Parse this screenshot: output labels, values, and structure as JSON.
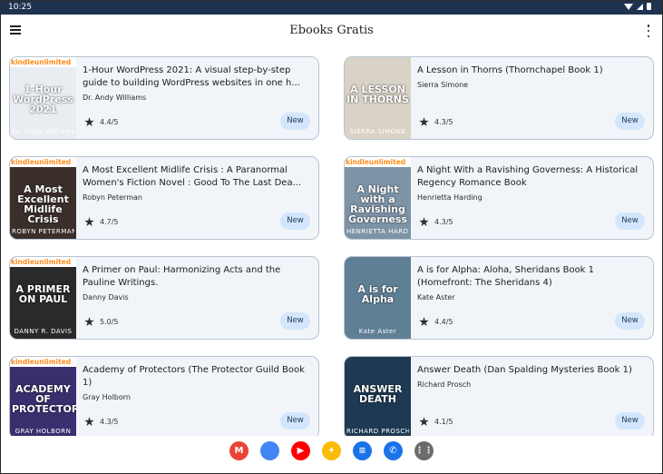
{
  "status": {
    "time": "10:25"
  },
  "appbar": {
    "title": "Ebooks Gratis",
    "menu_icon": "hamburger-menu-icon",
    "overflow_icon": "more-vert-icon"
  },
  "books": [
    {
      "title": "1-Hour WordPress 2021: A visual step-by-step guide to building WordPress websites in one h...",
      "author": "Dr. Andy Williams",
      "rating": "4.4/5",
      "badge": "New",
      "cover_band": "kindleunlimited",
      "cover_title": "1-Hour WordPress 2021",
      "cover_author": "Dr. Andy Williams",
      "cover_color": "#e9edf2"
    },
    {
      "title": "A Lesson in Thorns (Thornchapel Book 1)",
      "author": "Sierra Simone",
      "rating": "4.3/5",
      "badge": "New",
      "cover_band": "",
      "cover_title": "A LESSON IN THORNS",
      "cover_author": "SIERRA SIMONE",
      "cover_color": "#d9d2c6"
    },
    {
      "title": "A Most Excellent Midlife Crisis : A Paranormal Women's Fiction Novel : Good To The Last Dea...",
      "author": "Robyn Peterman",
      "rating": "4.7/5",
      "badge": "New",
      "cover_band": "kindleunlimited",
      "cover_title": "A Most Excellent Midlife Crisis",
      "cover_author": "ROBYN PETERMAN",
      "cover_color": "#3a2f2a"
    },
    {
      "title": "A Night With a Ravishing Governess: A Historical Regency Romance Book",
      "author": "Henrietta Harding",
      "rating": "4.3/5",
      "badge": "New",
      "cover_band": "kindleunlimited",
      "cover_title": "A Night with a Ravishing Governess",
      "cover_author": "HENRIETTA HARDING",
      "cover_color": "#7d93a6"
    },
    {
      "title": "A Primer on Paul: Harmonizing Acts and the Pauline Writings.",
      "author": "Danny Davis",
      "rating": "5.0/5",
      "badge": "New",
      "cover_band": "kindleunlimited",
      "cover_title": "A PRIMER ON PAUL",
      "cover_author": "DANNY R. DAVIS",
      "cover_color": "#2a2a2a"
    },
    {
      "title": "A is for Alpha: Aloha, Sheridans Book 1 (Homefront: The Sheridans 4)",
      "author": "Kate Aster",
      "rating": "4.4/5",
      "badge": "New",
      "cover_band": "",
      "cover_title": "A is for Alpha",
      "cover_author": "Kate Aster",
      "cover_color": "#5f7f95"
    },
    {
      "title": "Academy of Protectors (The Protector Guild Book 1)",
      "author": "Gray Holborn",
      "rating": "4.3/5",
      "badge": "New",
      "cover_band": "kindleunlimited",
      "cover_title": "ACADEMY OF PROTECTORS",
      "cover_author": "GRAY HOLBORN",
      "cover_color": "#3b2e6e"
    },
    {
      "title": "Answer Death (Dan Spalding Mysteries Book 1)",
      "author": "Richard Prosch",
      "rating": "4.1/5",
      "badge": "New",
      "cover_band": "",
      "cover_title": "ANSWER DEATH",
      "cover_author": "RICHARD PROSCH",
      "cover_color": "#1e3a52"
    }
  ],
  "dock": [
    {
      "name": "gmail-icon",
      "label": "M",
      "color": "#ea4335"
    },
    {
      "name": "chrome-icon",
      "label": "",
      "color": "#4285f4"
    },
    {
      "name": "youtube-icon",
      "label": "▶",
      "color": "#ff0000"
    },
    {
      "name": "photos-icon",
      "label": "✦",
      "color": "#fbbc04"
    },
    {
      "name": "messages-icon",
      "label": "≡",
      "color": "#1a73e8"
    },
    {
      "name": "phone-icon",
      "label": "✆",
      "color": "#1a73e8"
    },
    {
      "name": "app-drawer-icon",
      "label": "⋮⋮",
      "color": "#6b6b6b"
    }
  ]
}
